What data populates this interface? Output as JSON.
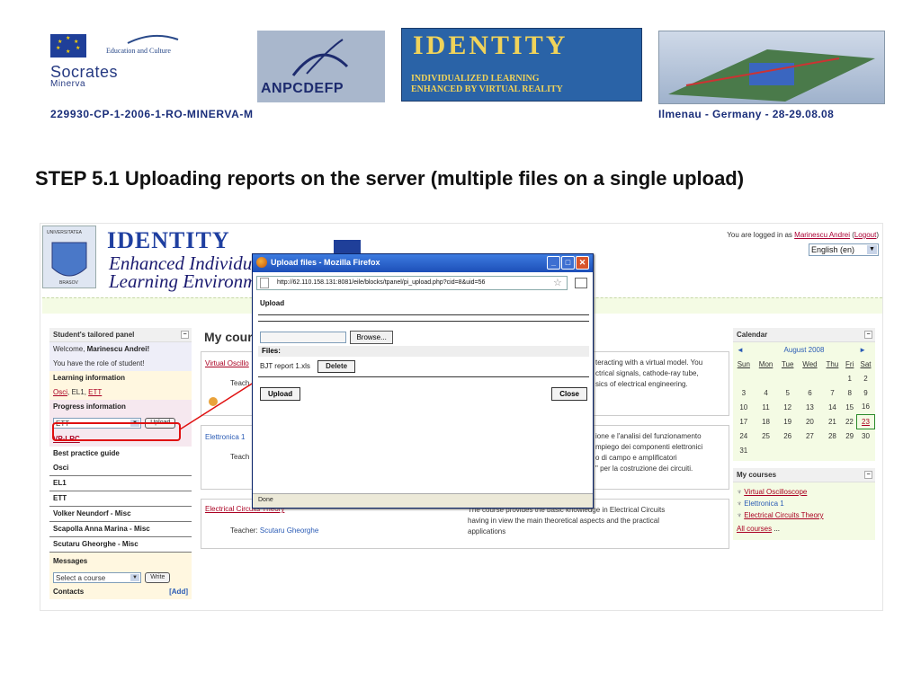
{
  "header": {
    "edu_culture": "Education and Culture",
    "socrates": "Socrates",
    "minerva": "Minerva",
    "project_code": "229930-CP-1-2006-1-RO-MINERVA-M",
    "anpc": "ANPCDEFP",
    "identity_title": "IDENTITY",
    "identity_sub1": "INDIVIDUALIZED LEARNING",
    "identity_sub2": "ENHANCED BY VIRTUAL REALITY",
    "location": "Ilmenau - Germany - 28-29.08.08"
  },
  "slide_title": "STEP 5.1 Uploading reports on the server (multiple files on a single upload)",
  "moodle": {
    "university": "UNIVERSITATEA",
    "brasov": "BRASOV",
    "site_name": "IDENTITY",
    "tagline1": "Enhanced Individual",
    "tagline2": "Learning Environment",
    "logged_prefix": "You are logged in as ",
    "logged_user": "Marinescu Andrei",
    "logout": "Logout",
    "language": "English (en)",
    "left_panel": {
      "title": "Student's tailored panel",
      "welcome": "Welcome, ",
      "welcome_name": "Marinescu Andrei!",
      "role": "You have the role of student!",
      "learning_title": "Learning information",
      "learning_links": [
        "Osci",
        "EL1",
        "ETT"
      ],
      "progress_title": "Progress information",
      "course_select": "ETT",
      "upload": "Upload",
      "vp_lrc": "VP-LRC",
      "best_practice": "Best practice guide",
      "bp_items": [
        "Osci",
        "EL1",
        "ETT",
        "Volker Neundorf - Misc",
        "Scapolla Anna Marina - Misc",
        "Scutaru Gheorghe - Misc"
      ],
      "messages": "Messages",
      "select_course": "Select a course",
      "write": "Write",
      "contacts": "Contacts",
      "add": "[Add]"
    },
    "center": {
      "title": "My cours",
      "courses": [
        {
          "link": "Virtual Oscillo",
          "teacher_label": "Teach",
          "desc": [
            "teracting with a virtual model. You",
            "ctrical signals, cathode-ray tube,",
            "sics of electrical engineering."
          ]
        },
        {
          "link": "Elettronica 1",
          "teacher_label": "Teach",
          "desc": [
            "ione e l'analisi del funzionamento",
            "mpiego dei componenti elettronici",
            "o di campo e amplificatori",
            "\" per la costruzione dei circuiti."
          ]
        },
        {
          "link": "Electrical Circuits Theory",
          "teacher_label": "Teacher: ",
          "teacher_name": "Scutaru Gheorghe",
          "desc": [
            "The course provides the basic knowledge in Electrical Circuits",
            "having in view the main theoretical aspects and the practical",
            "applications"
          ]
        }
      ]
    },
    "calendar": {
      "title": "Calendar",
      "month": "August 2008",
      "days": [
        "Sun",
        "Mon",
        "Tue",
        "Wed",
        "Thu",
        "Fri",
        "Sat"
      ],
      "weeks": [
        [
          "",
          "",
          "",
          "",
          "",
          "1",
          "2"
        ],
        [
          "3",
          "4",
          "5",
          "6",
          "7",
          "8",
          "9"
        ],
        [
          "10",
          "11",
          "12",
          "13",
          "14",
          "15",
          "16"
        ],
        [
          "17",
          "18",
          "19",
          "20",
          "21",
          "22",
          "23"
        ],
        [
          "24",
          "25",
          "26",
          "27",
          "28",
          "29",
          "30"
        ],
        [
          "31",
          "",
          "",
          "",
          "",
          "",
          ""
        ]
      ]
    },
    "my_courses": {
      "title": "My courses",
      "items": [
        "Virtual Oscilloscope",
        "Elettronica 1",
        "Electrical Circuits Theory"
      ],
      "all": "All courses",
      "ellipsis": " ..."
    }
  },
  "popup": {
    "title": "Upload files - Mozilla Firefox",
    "url": "http://62.110.158.131:8081/eile/blocks/tpanel/pi_upload.php?cid=8&uid=56",
    "heading": "Upload",
    "browse": "Browse...",
    "files_label": "Files:",
    "file_name": "BJT report 1.xls",
    "delete": "Delete",
    "upload": "Upload",
    "close": "Close",
    "status": "Done"
  },
  "colors": {
    "accent_red": "#e01010",
    "link": "#a02020",
    "titlebar": "#1d4fb8"
  }
}
